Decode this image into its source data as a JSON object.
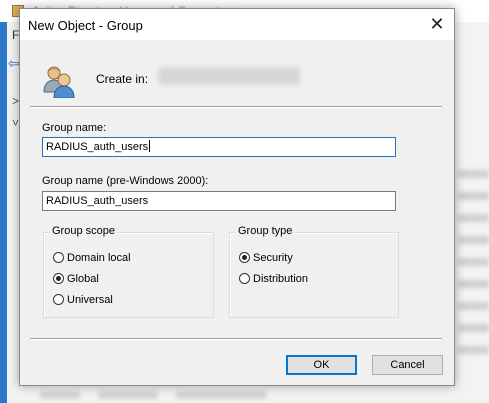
{
  "background": {
    "window_title": "Active Directory Users and Computers",
    "menu_first": "F",
    "tree_marks": [
      ">",
      "˅"
    ]
  },
  "dialog": {
    "title": "New Object - Group",
    "close_label": "✕",
    "create_in_label": "Create in:",
    "create_in_value": "",
    "group_name_label": "Group name:",
    "group_name_value": "RADIUS_auth_users",
    "group_name_pre2000_label": "Group name (pre-Windows 2000):",
    "group_name_pre2000_value": "RADIUS_auth_users",
    "group_scope": {
      "title": "Group scope",
      "options": [
        "Domain local",
        "Global",
        "Universal"
      ],
      "selected": "Global"
    },
    "group_type": {
      "title": "Group type",
      "options": [
        "Security",
        "Distribution"
      ],
      "selected": "Security"
    },
    "ok_label": "OK",
    "cancel_label": "Cancel"
  },
  "colors": {
    "accent": "#0078d7",
    "dialog_bg": "#f0f0f0",
    "focus_border": "#2b6fc0"
  }
}
